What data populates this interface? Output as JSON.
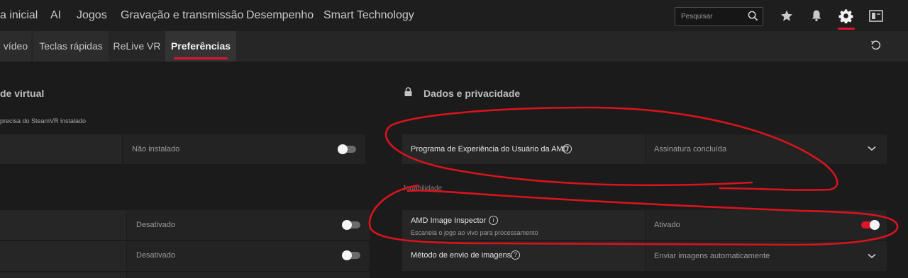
{
  "topnav": {
    "items": [
      "a inicial",
      "AI",
      "Jogos",
      "Gravação e transmissão",
      "Desempenho",
      "Smart Technology"
    ],
    "search_placeholder": "Pesquisar",
    "accent": "#e0142b"
  },
  "tabs": [
    "vídeo",
    "Teclas rápidas",
    "ReLive VR",
    "Preferências"
  ],
  "left": {
    "section_title": "de virtual",
    "note": "precisa do SteamVR instalado",
    "rows": [
      {
        "value": "Não instalado"
      },
      {
        "value": "Desativado"
      },
      {
        "value": "Desativado"
      }
    ]
  },
  "right": {
    "section_title": "Dados e privacidade",
    "program_label": "Programa de Experiência do Usuário da AMD",
    "program_value": "Assinatura concluída",
    "section2_title": "Jogabilidade",
    "inspector_label": "AMD Image Inspector",
    "inspector_sub": "Escaneia o jogo ao vivo para processamento",
    "inspector_value": "Ativado",
    "method_label": "Método de envio de imagens",
    "method_value": "Enviar imagens automaticamente"
  },
  "annotation_color": "#d8141c"
}
